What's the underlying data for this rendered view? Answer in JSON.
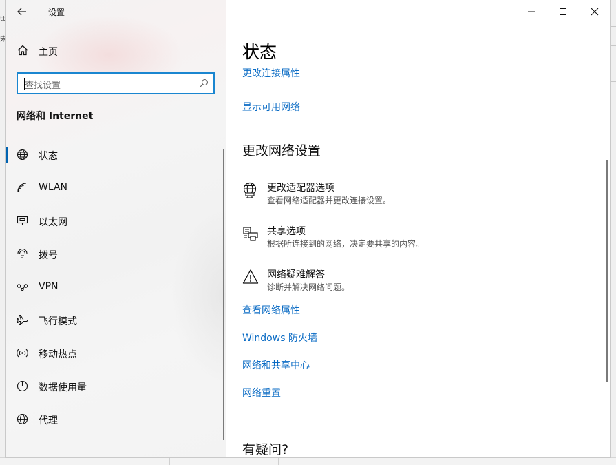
{
  "window": {
    "app_title": "设置",
    "controls": {
      "minimize": "—",
      "maximize": "☐",
      "close": "✕"
    }
  },
  "background": {
    "left_fragments": [
      "tt",
      "宋"
    ]
  },
  "sidebar": {
    "home_label": "主页",
    "search_placeholder": "查找设置",
    "section_title": "网络和 Internet",
    "items": [
      {
        "label": "状态",
        "icon": "globe-icon",
        "selected": true
      },
      {
        "label": "WLAN",
        "icon": "wifi-icon",
        "selected": false
      },
      {
        "label": "以太网",
        "icon": "ethernet-icon",
        "selected": false
      },
      {
        "label": "拨号",
        "icon": "dialup-icon",
        "selected": false
      },
      {
        "label": "VPN",
        "icon": "vpn-icon",
        "selected": false
      },
      {
        "label": "飞行模式",
        "icon": "airplane-icon",
        "selected": false
      },
      {
        "label": "移动热点",
        "icon": "hotspot-icon",
        "selected": false
      },
      {
        "label": "数据使用量",
        "icon": "data-usage-icon",
        "selected": false
      },
      {
        "label": "代理",
        "icon": "proxy-globe-icon",
        "selected": false
      }
    ]
  },
  "main": {
    "page_title": "状态",
    "links_top": [
      "更改连接属性",
      "显示可用网络"
    ],
    "change_settings_heading": "更改网络设置",
    "options": [
      {
        "title": "更改适配器选项",
        "desc": "查看网络适配器并更改连接设置。",
        "icon": "adapter-globe-icon"
      },
      {
        "title": "共享选项",
        "desc": "根据所连接到的网络，决定要共享的内容。",
        "icon": "sharing-printer-icon"
      },
      {
        "title": "网络疑难解答",
        "desc": "诊断并解决网络问题。",
        "icon": "warning-icon"
      }
    ],
    "links_bottom": [
      "查看网络属性",
      "Windows 防火墙",
      "网络和共享中心",
      "网络重置"
    ],
    "question_heading": "有疑问?"
  },
  "colors": {
    "accent": "#0063b1",
    "link": "#0a6bc4",
    "search_border": "#1a86d0"
  }
}
